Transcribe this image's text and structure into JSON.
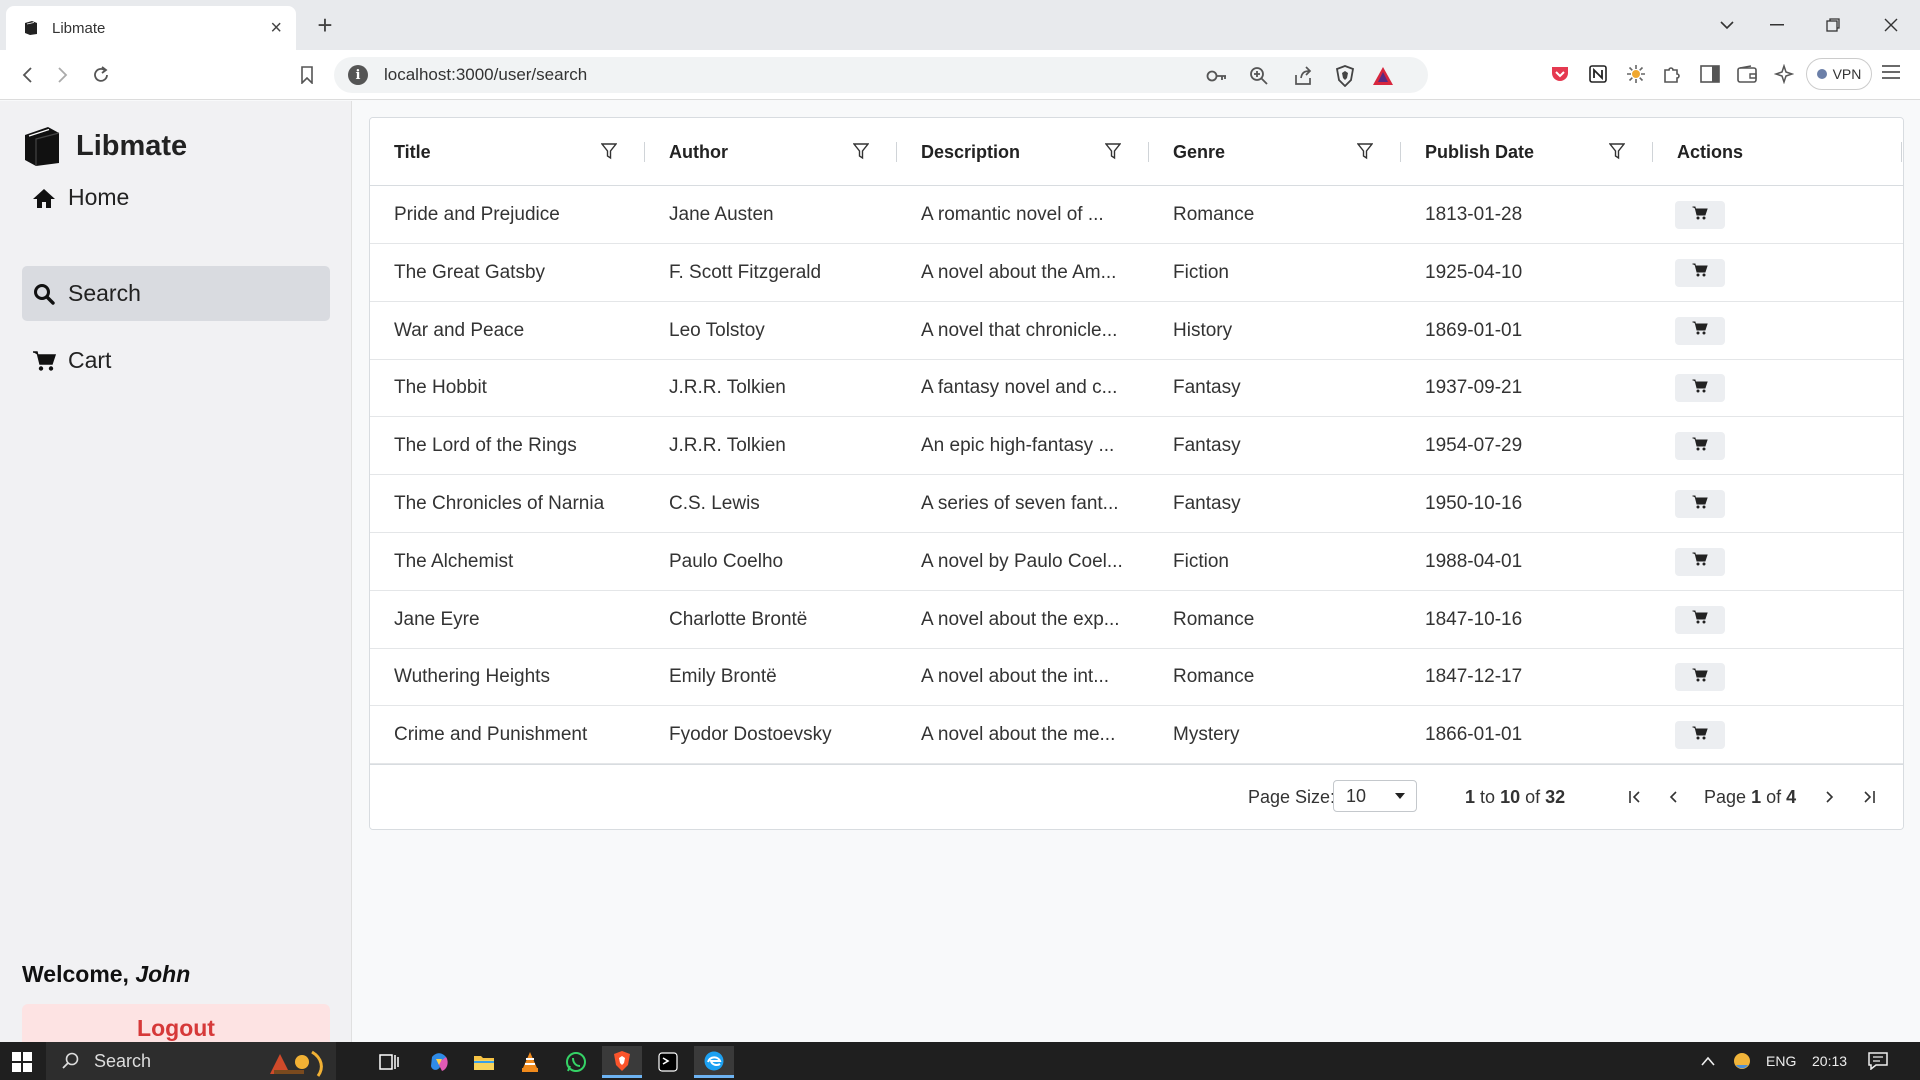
{
  "browser": {
    "tab_title": "Libmate",
    "url": "localhost:3000/user/search",
    "vpn_label": "VPN"
  },
  "sidebar": {
    "brand": "Libmate",
    "items": [
      {
        "label": "Home",
        "icon": "home-icon",
        "active": false
      },
      {
        "label": "Search",
        "icon": "search-icon",
        "active": true
      },
      {
        "label": "Cart",
        "icon": "cart-icon",
        "active": false
      }
    ],
    "welcome_prefix": "Welcome,",
    "username": "John",
    "logout_label": "Logout"
  },
  "grid": {
    "columns": [
      "Title",
      "Author",
      "Description",
      "Genre",
      "Publish Date",
      "Actions"
    ],
    "rows": [
      {
        "title": "Pride and Prejudice",
        "author": "Jane Austen",
        "description": "A romantic novel of ...",
        "genre": "Romance",
        "date": "1813-01-28"
      },
      {
        "title": "The Great Gatsby",
        "author": "F. Scott Fitzgerald",
        "description": "A novel about the Am...",
        "genre": "Fiction",
        "date": "1925-04-10"
      },
      {
        "title": "War and Peace",
        "author": "Leo Tolstoy",
        "description": "A novel that chronicle...",
        "genre": "History",
        "date": "1869-01-01"
      },
      {
        "title": "The Hobbit",
        "author": "J.R.R. Tolkien",
        "description": "A fantasy novel and c...",
        "genre": "Fantasy",
        "date": "1937-09-21"
      },
      {
        "title": "The Lord of the Rings",
        "author": "J.R.R. Tolkien",
        "description": "An epic high-fantasy ...",
        "genre": "Fantasy",
        "date": "1954-07-29"
      },
      {
        "title": "The Chronicles of Narnia",
        "author": "C.S. Lewis",
        "description": "A series of seven fant...",
        "genre": "Fantasy",
        "date": "1950-10-16"
      },
      {
        "title": "The Alchemist",
        "author": "Paulo Coelho",
        "description": "A novel by Paulo Coel...",
        "genre": "Fiction",
        "date": "1988-04-01"
      },
      {
        "title": "Jane Eyre",
        "author": "Charlotte Brontë",
        "description": "A novel about the exp...",
        "genre": "Romance",
        "date": "1847-10-16"
      },
      {
        "title": "Wuthering Heights",
        "author": "Emily Brontë",
        "description": "A novel about the int...",
        "genre": "Romance",
        "date": "1847-12-17"
      },
      {
        "title": "Crime and Punishment",
        "author": "Fyodor Dostoevsky",
        "description": "A novel about the me...",
        "genre": "Mystery",
        "date": "1866-01-01"
      }
    ],
    "footer": {
      "page_size_label": "Page Size:",
      "page_size_value": "10",
      "range_from": "1",
      "range_to_word": "to",
      "range_to": "10",
      "range_of_word": "of",
      "total": "32",
      "page_word": "Page",
      "current_page": "1",
      "page_of_word": "of",
      "total_pages": "4"
    }
  },
  "taskbar": {
    "search_placeholder": "Search",
    "language": "ENG",
    "time": "20:13"
  },
  "colors": {
    "sidebar_bg": "#f1f1f3",
    "active_item_bg": "#d9dbe0",
    "logout_bg": "#fde3e3",
    "logout_text": "#d63939"
  }
}
